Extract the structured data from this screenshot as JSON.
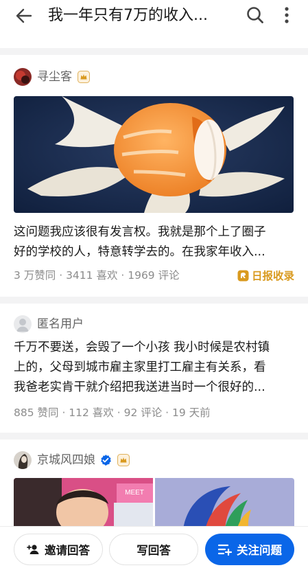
{
  "app_bar": {
    "title": "我一年只有7万的收入...",
    "back_icon": "arrow-left-icon",
    "search_icon": "search-icon",
    "more_icon": "more-vertical-icon"
  },
  "answers": [
    {
      "author": "寻尘客",
      "badge": "crown-badge-icon",
      "excerpt_lines": [
        "这问题我应该很有发言权。我就是那个上了圈子",
        "好的学校的人，特意转学去的。在我家年收入..."
      ],
      "meta": "3 万赞同 · 3411 喜欢 · 1969 评论",
      "daily_pick": "日报收录"
    },
    {
      "author": "匿名用户",
      "excerpt_lines": [
        "千万不要送，会毁了一个小孩 我小时候是农村镇",
        "上的，父母到城市雇主家里打工雇主有关系，看",
        "我爸老实肯干就介绍把我送进当时一个很好的..."
      ],
      "meta": "885 赞同 · 112 喜欢 · 92 评论 · 19 天前"
    },
    {
      "author": "京城风四娘",
      "badges": [
        "verified-icon",
        "crown-badge-icon"
      ],
      "image_text": "MEET"
    }
  ],
  "bottom_bar": {
    "invite_label": "邀请回答",
    "write_label": "写回答",
    "follow_label": "关注问题"
  },
  "colors": {
    "primary": "#0a66e8",
    "daily_gold": "#d99a1f",
    "meta_gray": "#8c8c8c"
  }
}
